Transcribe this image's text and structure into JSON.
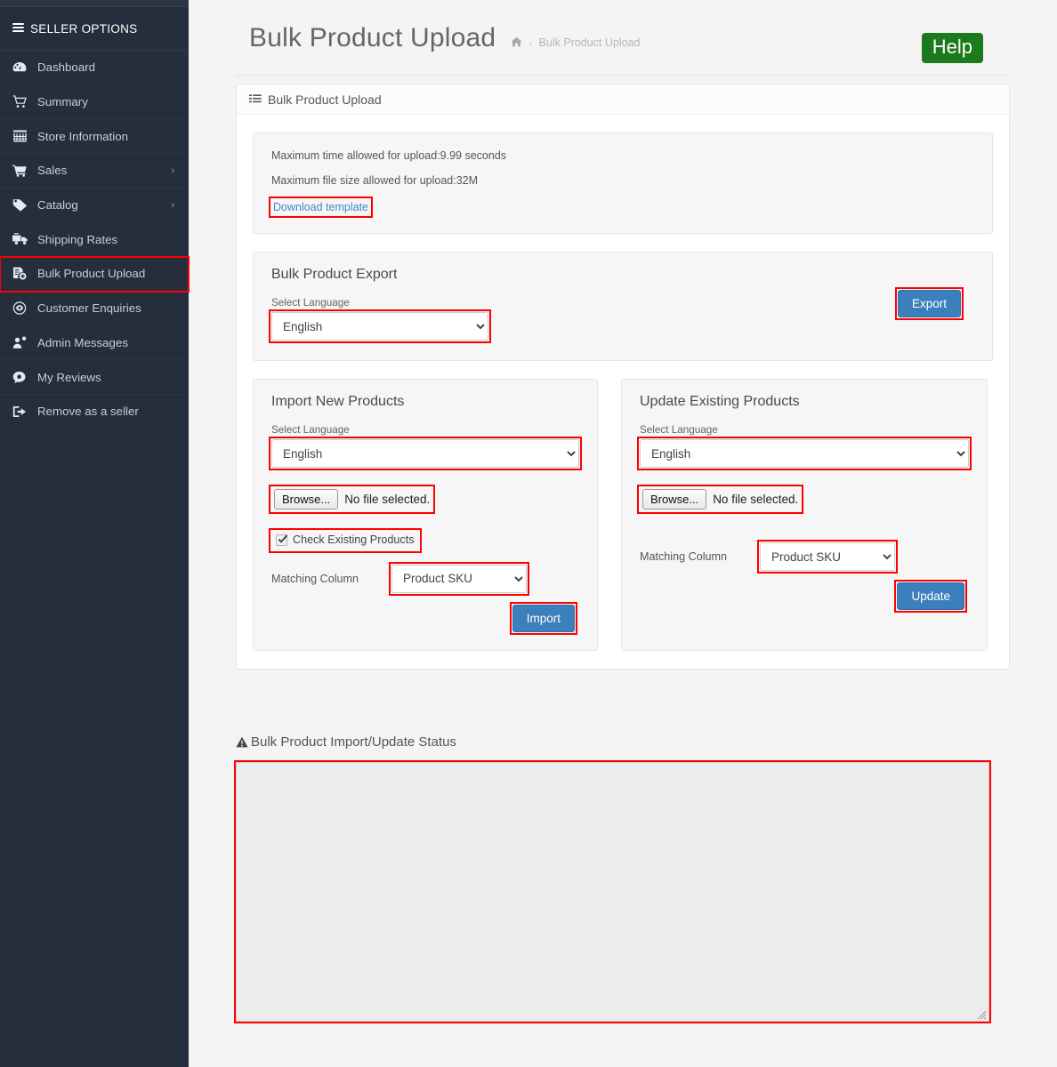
{
  "sidebar": {
    "header": "SELLER OPTIONS",
    "items": [
      {
        "label": "Dashboard",
        "icon": "dashboard-icon",
        "caret": false,
        "active": false
      },
      {
        "label": "Summary",
        "icon": "cart-summary-icon",
        "caret": false,
        "active": false
      },
      {
        "label": "Store Information",
        "icon": "store-icon",
        "caret": false,
        "active": false
      },
      {
        "label": "Sales",
        "icon": "cart-icon",
        "caret": true,
        "active": false
      },
      {
        "label": "Catalog",
        "icon": "tag-icon",
        "caret": true,
        "active": false
      },
      {
        "label": "Shipping Rates",
        "icon": "truck-icon",
        "caret": false,
        "active": false
      },
      {
        "label": "Bulk Product Upload",
        "icon": "file-upload-icon",
        "caret": false,
        "active": true
      },
      {
        "label": "Customer Enquiries",
        "icon": "eye-circle-icon",
        "caret": false,
        "active": false
      },
      {
        "label": "Admin Messages",
        "icon": "user-message-icon",
        "caret": false,
        "active": false
      },
      {
        "label": "My Reviews",
        "icon": "comment-icon",
        "caret": false,
        "active": false
      },
      {
        "label": "Remove as a seller",
        "icon": "signout-icon",
        "caret": false,
        "active": false
      }
    ],
    "caret_glyph": "›"
  },
  "header": {
    "title": "Bulk Product Upload",
    "breadcrumb_home_icon": "home-icon",
    "breadcrumb_separator": "›",
    "breadcrumb_current": "Bulk Product Upload",
    "help_label": "Help",
    "help_color": "#1b7a1b"
  },
  "portlet": {
    "title": "Bulk Product Upload",
    "title_icon": "list-icon"
  },
  "info": {
    "max_time": "Maximum time allowed for upload:9.99 seconds",
    "max_size": "Maximum file size allowed for upload:32M",
    "download_template": "Download template",
    "link_color": "#3c8dbc"
  },
  "export": {
    "title": "Bulk Product Export",
    "language_label": "Select Language",
    "language_value": "English",
    "language_options": [
      "English"
    ],
    "button_label": "Export"
  },
  "import": {
    "title": "Import New Products",
    "language_label": "Select Language",
    "language_value": "English",
    "language_options": [
      "English"
    ],
    "file_button_label": "Browse...",
    "file_status": "No file selected.",
    "check_existing_label": "Check Existing Products",
    "check_existing_checked": true,
    "matching_label": "Matching Column",
    "matching_value": "Product SKU",
    "matching_options": [
      "Product SKU"
    ],
    "button_label": "Import"
  },
  "update": {
    "title": "Update Existing Products",
    "language_label": "Select Language",
    "language_value": "English",
    "language_options": [
      "English"
    ],
    "file_button_label": "Browse...",
    "file_status": "No file selected.",
    "matching_label": "Matching Column",
    "matching_value": "Product SKU",
    "matching_options": [
      "Product SKU"
    ],
    "button_label": "Update"
  },
  "status": {
    "title": "Bulk Product Import/Update Status",
    "title_icon": "warning-icon",
    "textarea_value": "",
    "textarea_placeholder": ""
  },
  "annotations": {
    "highlight_color": "#ff0000"
  }
}
